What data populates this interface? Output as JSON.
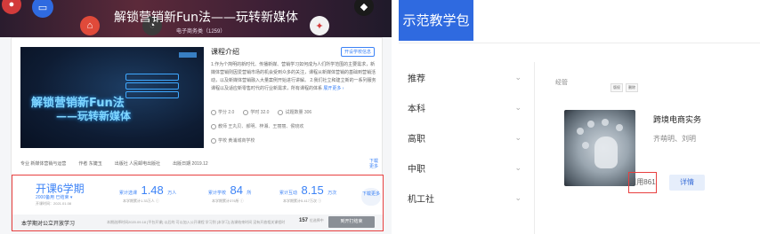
{
  "left": {
    "hero": {
      "title": "解锁营销新Fun法——玩转新媒体",
      "subtitle": "电子商务类（1259）"
    },
    "cover": {
      "title_line1": "解锁营销新Fun法",
      "title_line2": "——玩转新媒体"
    },
    "intro": {
      "title": "课程介绍",
      "button": "开设学校信息",
      "text": "1.作为个简明的新时代、传播新媒、营销学习如何成为人们所学范围的主要需求，新媒体营销则因爱营销市场的机会受到众多的关注，课程从新媒体营销的基础到营销活动，以及新媒体营销融入大量案例开始进行讲解。 2.我们社立和建立新的一系列服务课程以及适应新零售时代的行业新需求，所有课程的体系",
      "more": "展开更多 ›"
    },
    "meta": {
      "credits": "学分 2.0",
      "hours": "学时 32.0",
      "exercises": "试题数量 306",
      "teachers": "教师 王丸贝、郝明、梓湘、王丽丽、侯晓欢",
      "school": "学校 黄浦城商学校"
    },
    "info_row": [
      "专业 新媒体营销与运营",
      "作者 东婕玉",
      "出版社 人民邮电出版社",
      "出版日期 2019.12"
    ],
    "info_more": "下载更多",
    "stats": {
      "semester": "开课6学期",
      "semester_sub": "2000备用  已结束 ▾",
      "semester_time": "开课时间：2021.01.08",
      "schools_label": "累计选课",
      "schools_num": "1.48",
      "schools_unit": "万人",
      "schools_sub": "本学期累计1.33万人 ⓘ",
      "teachers_label": "累计学校",
      "teachers_num": "84",
      "teachers_unit": "所",
      "teachers_sub": "本学期累计376所 ⓘ",
      "visits_label": "累计互动",
      "visits_num": "8.15",
      "visits_unit": "万次",
      "visits_sub": "本学期累计5.417万次 ⓘ",
      "side_more": "下载更多"
    },
    "open_course": {
      "title": "本学期对公立开放学习",
      "desc": "本期选择时间2020.09.18 [平台开课]  以后的  可以加入公开课程  学习到 [本学习] 选课结束时间   没有开放相关课程时",
      "count": "157",
      "count_unit": "位选择中",
      "button": "到开打结束"
    }
  },
  "right": {
    "brand": "示范教学包",
    "nav": [
      "推荐",
      "本科",
      "高职",
      "中职",
      "机工社"
    ],
    "section_label": "经管",
    "tags": [
      "版权",
      "删除"
    ],
    "package": {
      "title": "跨境电商实务",
      "authors": "齐萌明、刘明",
      "cite": "引用861",
      "detail_button": "详情"
    }
  }
}
